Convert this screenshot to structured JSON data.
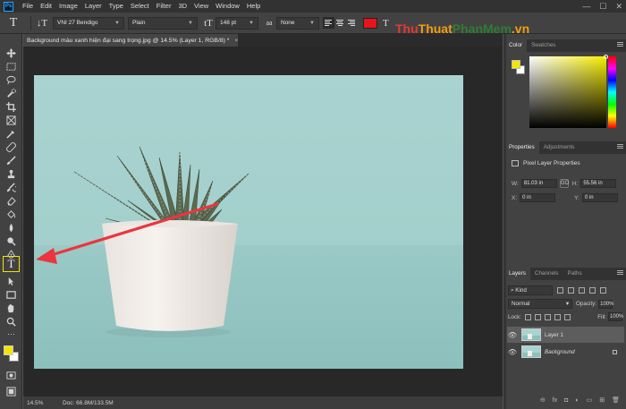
{
  "menubar": {
    "logo": "Ps",
    "items": [
      "File",
      "Edit",
      "Image",
      "Layer",
      "Type",
      "Select",
      "Filter",
      "3D",
      "View",
      "Window",
      "Help"
    ]
  },
  "window_controls": [
    "—",
    "☐",
    "✕"
  ],
  "options": {
    "tool_glyph": "T",
    "orientation_glyph": "↓T",
    "font_family": "VNI 27 Bendigo",
    "font_style": "Plain",
    "size_glyph": "tT",
    "font_size": "148 pt",
    "aa_glyph": "aa",
    "antialias": "None",
    "text_color": "#e8141b",
    "warp_glyph": "T"
  },
  "watermark": {
    "part1": "Thu",
    "part2": "Thuat",
    "part3": "PhanMem",
    "part4": ".vn"
  },
  "document": {
    "tab_title": "Background màu xanh hiện đại sang trọng.jpg @ 14.5% (Layer 1, RGB/8) *",
    "close": "×"
  },
  "status": {
    "zoom": "14.5%",
    "doc_size": "Doc: 66.8M/133.5M"
  },
  "toolbar": {
    "type_tool_glyph": "T",
    "foreground_color": "#f5e400",
    "background_color": "#ffffff"
  },
  "color_panel": {
    "tabs": [
      "Color",
      "Swatches"
    ],
    "foreground": "#f5e400",
    "background": "#ffffff",
    "hue_color": "#f6ec00"
  },
  "properties_panel": {
    "tabs": [
      "Properties",
      "Adjustments"
    ],
    "title": "Pixel Layer Properties",
    "w_label": "W:",
    "w_value": "81.03 in",
    "h_label": "H:",
    "h_value": "55.56 in",
    "link_glyph": "GO",
    "x_label": "X:",
    "x_value": "0 in",
    "y_label": "Y:",
    "y_value": "0 in"
  },
  "layers_panel": {
    "tabs": [
      "Layers",
      "Channels",
      "Paths"
    ],
    "kind": "Kind",
    "blend_mode": "Normal",
    "opacity_label": "Opacity:",
    "opacity_value": "100%",
    "lock_label": "Lock:",
    "fill_label": "Fill:",
    "fill_value": "100%",
    "layers": [
      {
        "name": "Layer 1",
        "selected": true
      },
      {
        "name": "Background",
        "selected": false
      }
    ],
    "footer_icons": [
      "link-icon",
      "fx-icon",
      "mask-icon",
      "adjustment-icon",
      "folder-icon",
      "new-layer-icon",
      "trash-icon"
    ],
    "footer_glyphs": [
      "⊖",
      "fx",
      "◘",
      "◐",
      "▭",
      "⊞",
      "🗑"
    ]
  }
}
